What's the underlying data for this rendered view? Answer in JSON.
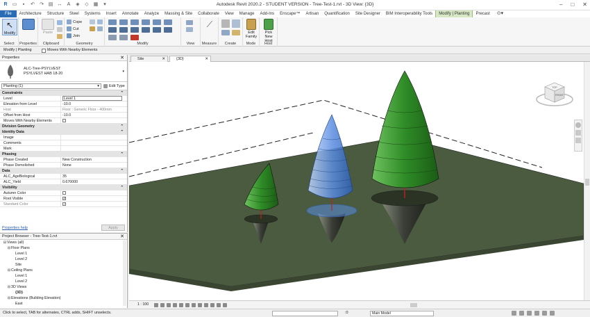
{
  "titlebar": {
    "title": "Autodesk Revit 2020.2 - STUDENT VERSION - Tree-Test-1.rvt - 3D View: {3D}"
  },
  "tabs": [
    {
      "label": "File",
      "kind": "file"
    },
    {
      "label": "Architecture"
    },
    {
      "label": "Structure"
    },
    {
      "label": "Steel"
    },
    {
      "label": "Systems"
    },
    {
      "label": "Insert"
    },
    {
      "label": "Annotate"
    },
    {
      "label": "Analyze"
    },
    {
      "label": "Massing & Site"
    },
    {
      "label": "Collaborate"
    },
    {
      "label": "View"
    },
    {
      "label": "Manage"
    },
    {
      "label": "Add-Ins"
    },
    {
      "label": "Enscape™"
    },
    {
      "label": "Artisan"
    },
    {
      "label": "Quantification"
    },
    {
      "label": "Site Designer"
    },
    {
      "label": "BIM Interoperability Tools"
    },
    {
      "label": "Modify | Planting",
      "kind": "active"
    },
    {
      "label": "Precast"
    }
  ],
  "ribbon": {
    "modify_label": "Modify",
    "paste_label": "Paste",
    "cope_label": "Cope",
    "cut_label": "Cut",
    "join_label": "Join",
    "edit_family_label": "Edit Family",
    "pick_new_host_label": "Pick New Host",
    "panels": {
      "select": "Select",
      "properties": "Properties",
      "clipboard": "Clipboard",
      "geometry": "Geometry",
      "modify": "Modify",
      "view": "View",
      "measure": "Measure",
      "create": "Create",
      "mode": "Mode",
      "host": "Host"
    }
  },
  "options_bar": {
    "context": "Modify | Planting",
    "moves_with_nearby": "Moves With Nearby Elements"
  },
  "properties": {
    "title": "Properties",
    "family": "ALC-Tree-PSYLVEST",
    "type": "PSYLVEST HAB 18-20",
    "instance_selector": "Planting (1)",
    "edit_type": "Edit Type",
    "rows": [
      {
        "group": "Constraints"
      },
      {
        "k": "Level",
        "v": "Level 1",
        "box": true
      },
      {
        "k": "Elevation from Level",
        "v": "-10.0"
      },
      {
        "k": "Host",
        "v": "Floor : Generic Floor - 400mm",
        "gray": true
      },
      {
        "k": "Offset from Host",
        "v": "-10.0"
      },
      {
        "k": "Moves With Nearby Elements",
        "cb": true
      },
      {
        "group": "Division Geometry"
      },
      {
        "group": "Identity Data"
      },
      {
        "k": "Image",
        "v": ""
      },
      {
        "k": "Comments",
        "v": ""
      },
      {
        "k": "Mark",
        "v": ""
      },
      {
        "group": "Phasing"
      },
      {
        "k": "Phase Created",
        "v": "New Construction"
      },
      {
        "k": "Phase Demolished",
        "v": "None"
      },
      {
        "group": "Data"
      },
      {
        "k": "ALC_AgeBiological",
        "v": "35"
      },
      {
        "k": "ALC_Yield",
        "v": "0.670000"
      },
      {
        "group": "Visibility"
      },
      {
        "k": "Autumn Color",
        "cb": true
      },
      {
        "k": "Root Visible",
        "cb": true,
        "checked": true
      },
      {
        "k": "Standard Color",
        "cb": true,
        "checked": true,
        "gray": true
      }
    ],
    "help_link": "Properties help",
    "apply": "Apply"
  },
  "browser": {
    "title": "Project Browser - Tree-Test-1.rvt",
    "nodes": [
      {
        "label": "Views (all)",
        "depth": 0,
        "toggle": "⊟"
      },
      {
        "label": "Floor Plans",
        "depth": 1,
        "toggle": "⊟"
      },
      {
        "label": "Level 1",
        "depth": 3
      },
      {
        "label": "Level 2",
        "depth": 3
      },
      {
        "label": "Site",
        "depth": 3
      },
      {
        "label": "Ceiling Plans",
        "depth": 1,
        "toggle": "⊟"
      },
      {
        "label": "Level 1",
        "depth": 3
      },
      {
        "label": "Level 2",
        "depth": 3
      },
      {
        "label": "3D Views",
        "depth": 1,
        "toggle": "⊟"
      },
      {
        "label": "{3D}",
        "depth": 3,
        "bold": true
      },
      {
        "label": "Elevations (Building Elevation)",
        "depth": 1,
        "toggle": "⊟"
      },
      {
        "label": "East",
        "depth": 3
      }
    ]
  },
  "view_tabs": {
    "site": "Site",
    "view3d": "{3D}"
  },
  "view_control": {
    "scale": "1 : 100"
  },
  "viewcube": {
    "top": "TOP",
    "front": "FRONT"
  },
  "statusbar": {
    "message": "Click to select, TAB for alternates, CTRL adds, SHIFT unselects.",
    "coord": ":0",
    "model": "Main Model"
  },
  "colors": {
    "tree_green": "#2e8b26",
    "tree_blue": "#5a8de0",
    "ground": "#4b5b3f",
    "active_tab": "#d7e8c4",
    "file_tab": "#2a6db5"
  }
}
